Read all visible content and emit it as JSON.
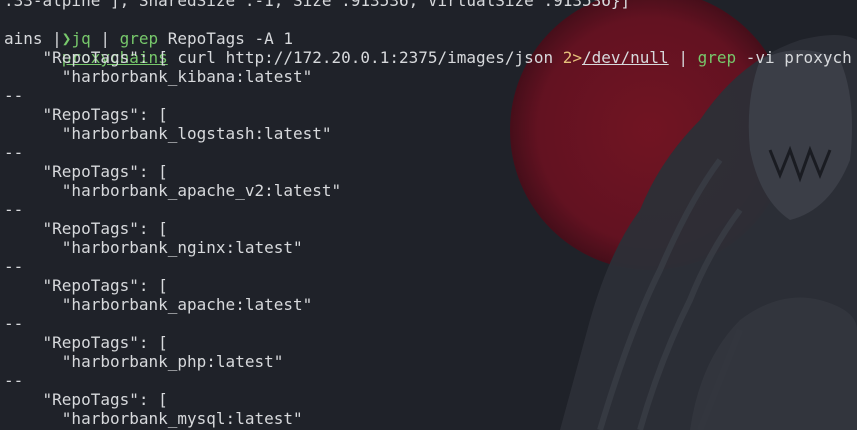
{
  "partial_top_line": ":33-alpine\"],\"SharedSize\":-1,\"Size\":913536,\"VirtualSize\":913536}]",
  "prompt": {
    "symbol": "❯",
    "cmd1": "proxychains",
    "args1": " curl http://172.20.0.1:2375/images/json ",
    "redirect": "2>",
    "devnull": "/dev/null",
    "pipe1": " | ",
    "cmd2": "grep",
    "args2": " -vi proxych",
    "wrap": "ains",
    "pipe2": " | ",
    "cmd3": "jq",
    "pipe3": " | ",
    "cmd4": "grep",
    "args4": " RepoTags -A 1"
  },
  "output": [
    {
      "key": "    \"RepoTags\": [",
      "val": "      \"harborbank_kibana:latest\""
    },
    {
      "sep": "--",
      "key": "    \"RepoTags\": [",
      "val": "      \"harborbank_logstash:latest\""
    },
    {
      "sep": "--",
      "key": "    \"RepoTags\": [",
      "val": "      \"harborbank_apache_v2:latest\""
    },
    {
      "sep": "--",
      "key": "    \"RepoTags\": [",
      "val": "      \"harborbank_nginx:latest\""
    },
    {
      "sep": "--",
      "key": "    \"RepoTags\": [",
      "val": "      \"harborbank_apache:latest\""
    },
    {
      "sep": "--",
      "key": "    \"RepoTags\": [",
      "val": "      \"harborbank_php:latest\""
    },
    {
      "sep": "--",
      "key": "    \"RepoTags\": [",
      "val": "      \"harborbank_mysql:latest\""
    }
  ]
}
